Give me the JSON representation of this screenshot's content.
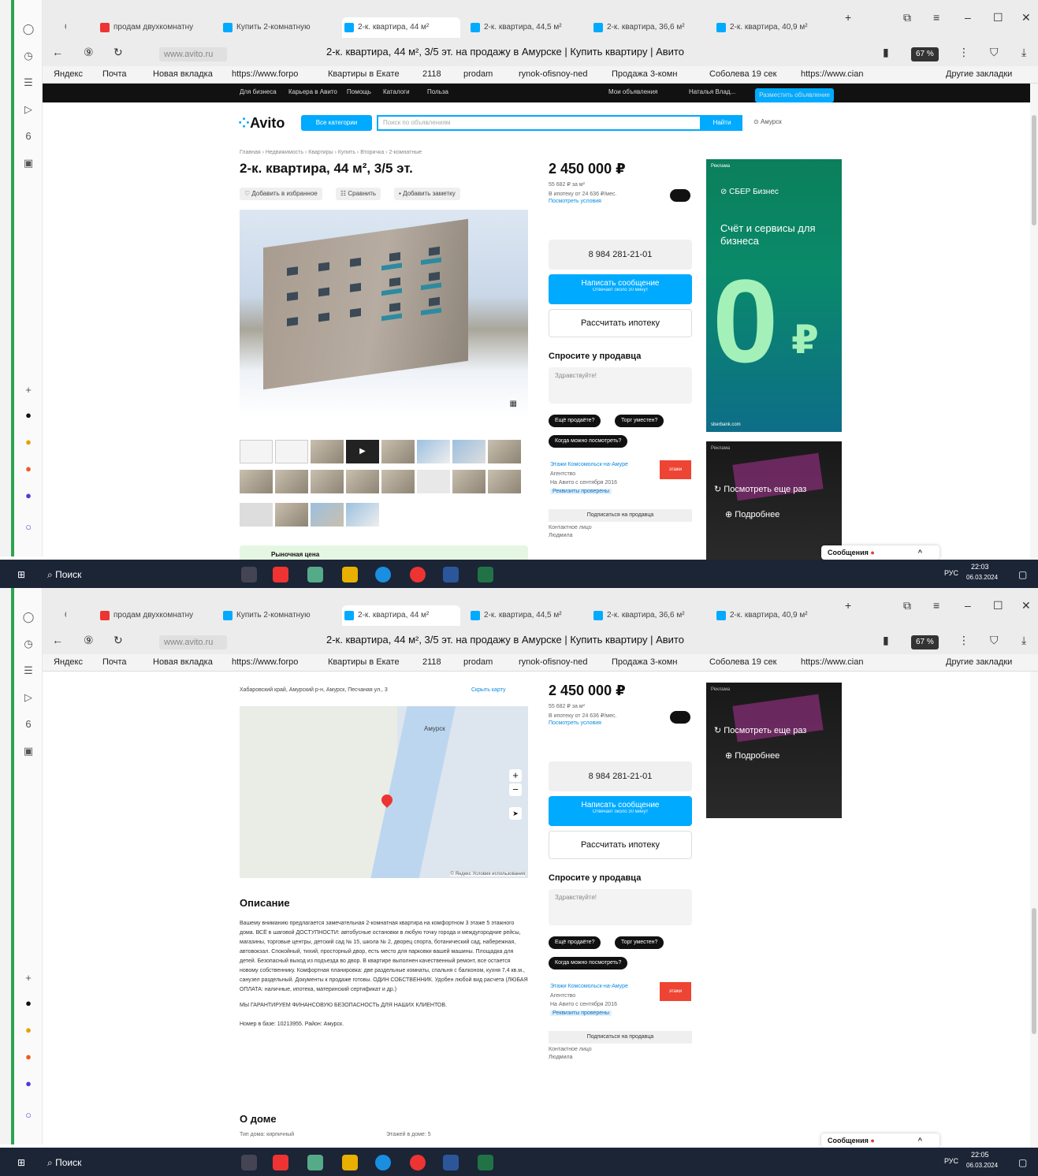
{
  "browser": {
    "tab_count": "6",
    "tabs": [
      "продам двухкомнатну",
      "Купить 2-комнатную",
      "2-к. квартира, 44 м²",
      "2-к. квартира, 44,5 м²",
      "2-к. квартира, 36,6 м²",
      "2-к. квартира, 40,9 м²"
    ],
    "url": "www.avito.ru",
    "page_title": "2-к. квартира, 44 м², 3/5 эт. на продажу в Амурске | Купить квартиру | Авито",
    "battery_badge": "67 %",
    "bookmarks": [
      "Яндекс",
      "Почта",
      "Новая вкладка",
      "https://www.forpo",
      "Квартиры в Екате",
      "2118",
      "prodam",
      "rynok-ofisnoy-ned",
      "Продажа 3-комн",
      "Соболева 19 сек",
      "https://www.cian"
    ],
    "other_bookmarks": "Другие закладки",
    "accent": "#00aaff"
  },
  "site": {
    "topnav": [
      "Для бизнеса",
      "Карьера в Авито",
      "Помощь",
      "Каталоги",
      "Польза"
    ],
    "my_ads": "Мои объявления",
    "user": "Наталья Влад...",
    "post_ad": "Разместить объявление",
    "logo": "Avito",
    "categories_btn": "Все категории",
    "search_placeholder": "Поиск по объявлениям",
    "find_btn": "Найти",
    "location": "Амурск"
  },
  "listing": {
    "breadcrumb": "Главная › Недвижимость › Квартиры › Купить › Вторичка › 2-комнатные",
    "title": "2-к. квартира, 44 м², 3/5 эт.",
    "actions": [
      "Добавить в избранное",
      "Сравнить",
      "Добавить заметку"
    ],
    "price": "2 450 000 ₽",
    "price_per_m2": "55 682 ₽ за м²",
    "mortgage_note": "В ипотеку от 24 636 ₽/мес.",
    "mortgage_link": "Посмотреть условия",
    "phone": "8 984 281-21-01",
    "message_btn": "Написать сообщение",
    "message_sub": "Отвечает около 30 минут",
    "mortgage_btn": "Рассчитать ипотеку",
    "ask_title": "Спросите у продавца",
    "ask_placeholder": "Здравствуйте!",
    "chips": [
      "Ещё продаёте?",
      "Торг уместен?",
      "Когда можно посмотреть?"
    ],
    "seller_name": "Этажи Комсомольск-на-Амуре",
    "seller_type": "Агентство",
    "seller_since": "На Авито с сентября 2016",
    "seller_badge": "Реквизиты проверены",
    "agency_logo": "этажи",
    "subscribe": "Подписаться на продавца",
    "contact_label": "Контактное лицо",
    "contact_name": "Людмила",
    "market_price": "Рыночная цена",
    "messages": "Сообщения"
  },
  "ads": {
    "sber_brand": "СБЕР Бизнес",
    "sber_text": "Счёт и сервисы для бизнеса",
    "sber_zero": "0",
    "sber_rub": "₽",
    "sber_url": "sberbank.com",
    "label": "Реклама",
    "watch_again": "Посмотреть еще раз",
    "more": "Подробнее"
  },
  "map_section": {
    "address": "Хабаровский край, Амурский р-н, Амурск, Песчаная ул., 3",
    "hide_map": "Скрыть карту",
    "city_label": "Амурск",
    "copyright": "© Яндекс Условия использования"
  },
  "description": {
    "title": "Описание",
    "text": "Вашему вниманию предлагается замечательная 2-комнатная квартира на комфортном 3 этаже 5 этажного дома. ВСЁ в шаговой ДОСТУПНОСТИ: автобусные остановки в любую точку города и междугородние рейсы, магазины, торговые центры, детский сад № 15, школа № 2, дворец спорта, ботанический сад, набережная, автовокзал. Спокойный, тихий, просторный двор, есть место для парковки вашей машины. Площадка для детей. Безопасный выход из подъезда во двор. В квартире выполнен качественный ремонт, все остается новому собственнику. Комфортная планировка: две раздельные комнаты, спальня с балконом, кухня 7,4 кв.м., санузел раздельный. Документы к продаже готовы. ОДИН СОБСТВЕННИК. Удобен любой вид расчета (ЛЮБАЯ ОПЛАТА: наличные, ипотека, материнский сертификат и др.)",
    "guarantee": "МЫ ГАРАНТИРУЕМ ФИНАНСОВУЮ БЕЗОПАСНОСТЬ ДЛЯ НАШИХ КЛИЕНТОВ.",
    "base_no": "Номер в базе: 10213955. Район: Амурск."
  },
  "house": {
    "title": "О доме",
    "type": "Тип дома: кирпичный",
    "floors": "Этажей в доме: 5"
  },
  "taskbar": {
    "search": "Поиск",
    "lang": "РУС",
    "time1": "22:03",
    "date1": "06.03.2024",
    "time2": "22:05",
    "date2": "06.03.2024"
  }
}
